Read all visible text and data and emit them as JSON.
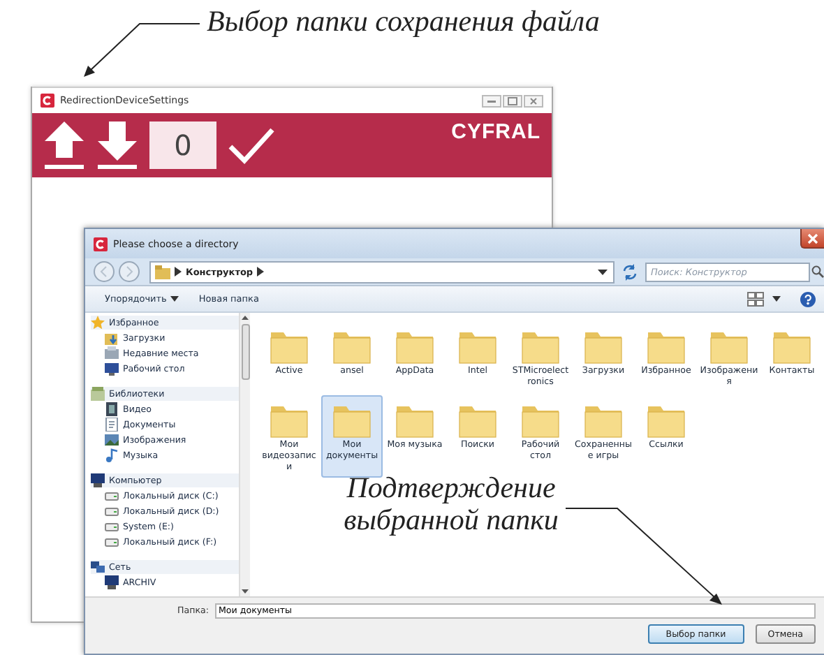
{
  "annotations": [
    {
      "text": "Выбор папки сохранения файла",
      "kind": "top"
    },
    {
      "text": "Подтверждение выбранной папки",
      "kind": "bottom"
    }
  ],
  "settings_window": {
    "title": "RedirectionDeviceSettings",
    "counter": "0",
    "brand": "CYFRAL"
  },
  "dialog": {
    "title": "Please choose a directory",
    "breadcrumb": "Конструктор",
    "search": {
      "placeholder": "Поиск: Конструктор"
    },
    "toolbar": [
      {
        "label": "Упорядочить",
        "dropdown": true
      },
      {
        "label": "Новая папка",
        "dropdown": false
      }
    ],
    "nav": [
      {
        "label": "Избранное",
        "kind": "star",
        "children": [
          {
            "label": "Загрузки",
            "kind": "download"
          },
          {
            "label": "Недавние места",
            "kind": "recent"
          },
          {
            "label": "Рабочий стол",
            "kind": "desktop"
          }
        ]
      },
      {
        "label": "Библиотеки",
        "kind": "library",
        "children": [
          {
            "label": "Видео",
            "kind": "video"
          },
          {
            "label": "Документы",
            "kind": "document"
          },
          {
            "label": "Изображения",
            "kind": "picture"
          },
          {
            "label": "Музыка",
            "kind": "music"
          }
        ]
      },
      {
        "label": "Компьютер",
        "kind": "computer",
        "children": [
          {
            "label": "Локальный диск (C:)",
            "kind": "drive"
          },
          {
            "label": "Локальный диск (D:)",
            "kind": "drive"
          },
          {
            "label": "System (E:)",
            "kind": "drive"
          },
          {
            "label": "Локальный диск (F:)",
            "kind": "drive"
          }
        ]
      },
      {
        "label": "Сеть",
        "kind": "network",
        "children": [
          {
            "label": "ARCHIV",
            "kind": "computer"
          }
        ]
      }
    ],
    "folders": [
      {
        "label": "Active",
        "selected": false
      },
      {
        "label": "ansel",
        "selected": false
      },
      {
        "label": "AppData",
        "selected": false
      },
      {
        "label": "Intel",
        "selected": false
      },
      {
        "label": "STMicroelectronics",
        "selected": false
      },
      {
        "label": "Загрузки",
        "selected": false
      },
      {
        "label": "Избранное",
        "selected": false
      },
      {
        "label": "Изображения",
        "selected": false
      },
      {
        "label": "Контакты",
        "selected": false
      },
      {
        "label": "Мои видеозаписи",
        "selected": false
      },
      {
        "label": "Мои документы",
        "selected": true
      },
      {
        "label": "Моя музыка",
        "selected": false
      },
      {
        "label": "Поиски",
        "selected": false
      },
      {
        "label": "Рабочий стол",
        "selected": false
      },
      {
        "label": "Сохраненные игры",
        "selected": false
      },
      {
        "label": "Ссылки",
        "selected": false
      }
    ],
    "folder_field": {
      "label": "Папка:",
      "value": "Мои документы"
    },
    "buttons": [
      {
        "label": "Выбор папки",
        "kind": "default"
      },
      {
        "label": "Отмена",
        "kind": "normal"
      }
    ]
  }
}
